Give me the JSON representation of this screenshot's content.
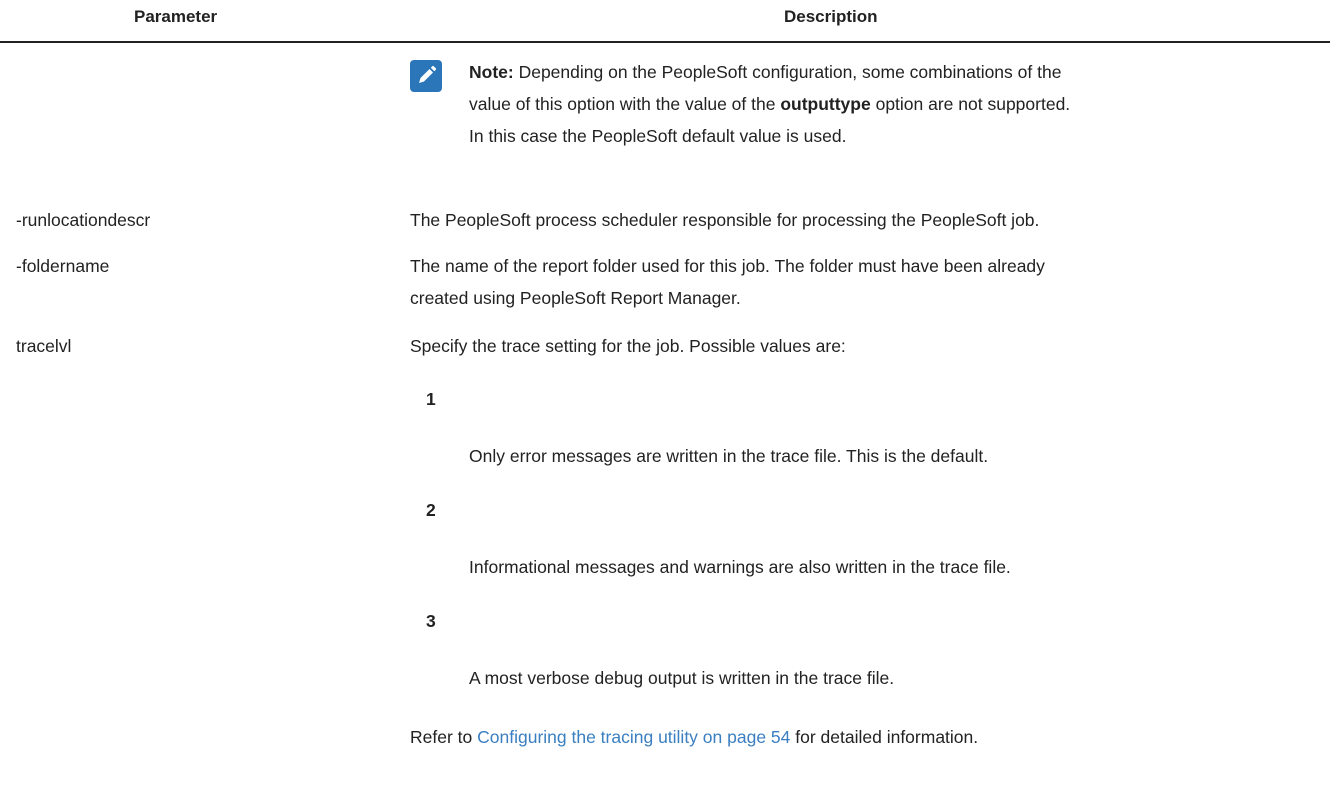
{
  "table": {
    "headers": {
      "parameter": "Parameter",
      "description": "Description"
    },
    "note": {
      "label": "Note:",
      "text1": " Depending on the PeopleSoft configuration, some combinations of the",
      "text2a": "value of this option with the value of the ",
      "option": "outputtype",
      "text2b": " option are not supported.",
      "text3": "In this case the PeopleSoft default value is used."
    },
    "rows": [
      {
        "param": "-runlocationdescr",
        "desc": [
          "The PeopleSoft process scheduler responsible for processing the PeopleSoft job."
        ]
      },
      {
        "param": "-foldername",
        "desc": [
          "The name of the report folder used for this job. The folder must have been already",
          "created using PeopleSoft Report Manager."
        ]
      },
      {
        "param": "tracelvl",
        "desc": [
          "Specify the trace setting for the job. Possible values are:"
        ]
      }
    ],
    "trace_values": [
      {
        "value": "1",
        "text": "Only error messages are written in the trace file. This is the default."
      },
      {
        "value": "2",
        "text": "Informational messages and warnings are also written in the trace file."
      },
      {
        "value": "3",
        "text": "A most verbose debug output is written in the trace file."
      }
    ],
    "refer": {
      "prefix": "Refer to ",
      "link": "Configuring the tracing utility on page 54",
      "suffix": " for detailed information."
    }
  },
  "colors": {
    "link": "#3a7fc1",
    "note_icon": "#2a76b8",
    "text": "#222222"
  }
}
